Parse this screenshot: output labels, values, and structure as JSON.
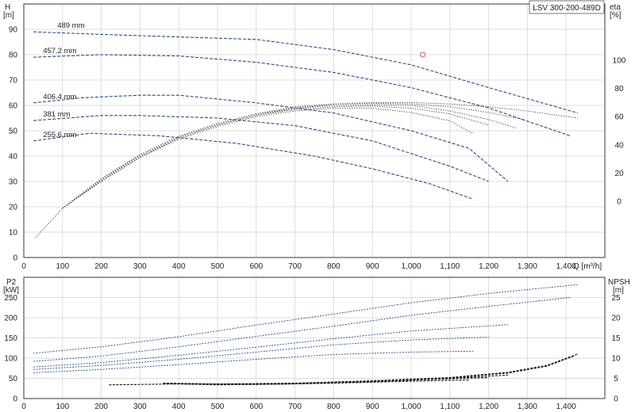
{
  "badge": "LSV 300-200-489D",
  "colors": {
    "curve": "#1f4e8c",
    "eff": "#555555",
    "npsh": "#111111",
    "grid": "#d0d0d0",
    "marker": "#e05050"
  },
  "chart_data": [
    {
      "type": "line",
      "panel": "head",
      "ylabel_name": "H",
      "ylabel_unit": "[m]",
      "y2label_name": "eta",
      "y2label_unit": "[%]",
      "xlabel": "Q [m³/h]",
      "xlim": [
        0,
        1500
      ],
      "ylim": [
        0,
        100
      ],
      "y2lim": [
        -40,
        140
      ],
      "xticks": [
        0,
        100,
        200,
        300,
        400,
        500,
        600,
        700,
        800,
        900,
        1000,
        1100,
        1200,
        1300,
        1400
      ],
      "xtick_labels": [
        "0",
        "100",
        "200",
        "300",
        "400",
        "500",
        "600",
        "700",
        "800",
        "900",
        "1,000",
        "1,100",
        "1,200",
        "1,300",
        "1,400"
      ],
      "yticks": [
        0,
        10,
        20,
        30,
        40,
        50,
        60,
        70,
        80,
        90
      ],
      "y2ticks": [
        0,
        20,
        40,
        60,
        80,
        100
      ],
      "series": [
        {
          "name": "489 mm",
          "x": [
            25,
            200,
            400,
            600,
            800,
            1000,
            1200,
            1430
          ],
          "y": [
            89,
            88,
            87,
            86,
            82,
            76,
            67,
            57
          ]
        },
        {
          "name": "457.2 mm",
          "x": [
            25,
            200,
            400,
            600,
            800,
            1000,
            1200,
            1410
          ],
          "y": [
            79,
            80,
            79.5,
            77,
            73,
            67,
            59,
            48
          ]
        },
        {
          "name": "406.4 mm",
          "x": [
            25,
            150,
            300,
            400,
            600,
            800,
            1000,
            1150,
            1250
          ],
          "y": [
            61,
            63,
            64,
            64,
            61,
            57,
            50,
            43,
            30
          ]
        },
        {
          "name": "381 mm",
          "x": [
            25,
            200,
            300,
            500,
            700,
            900,
            1100,
            1200
          ],
          "y": [
            54,
            56,
            56,
            55,
            52,
            46,
            36,
            30
          ]
        },
        {
          "name": "255.6 mm",
          "x": [
            25,
            170,
            350,
            550,
            750,
            900,
            1050,
            1160
          ],
          "y": [
            46,
            49,
            48,
            45,
            40,
            35,
            29,
            23
          ]
        }
      ],
      "efficiency": [
        {
          "x": [
            100,
            200,
            300,
            400,
            500,
            600,
            700,
            800,
            900,
            1000,
            1100,
            1200,
            1300,
            1430
          ],
          "y": [
            -5,
            16,
            33,
            46,
            55,
            62,
            67,
            69,
            70,
            70,
            69,
            67,
            64,
            59
          ]
        },
        {
          "x": [
            100,
            200,
            300,
            400,
            500,
            600,
            700,
            800,
            900,
            1000,
            1100,
            1200,
            1290
          ],
          "y": [
            -5,
            15,
            33,
            46,
            55,
            62,
            66,
            69,
            69.5,
            69,
            67,
            63,
            58
          ]
        },
        {
          "x": [
            100,
            200,
            300,
            400,
            500,
            600,
            700,
            800,
            900,
            1000,
            1100,
            1200,
            1270
          ],
          "y": [
            -5,
            15,
            32,
            45,
            54,
            61,
            66,
            68,
            68.5,
            68,
            64,
            58,
            52
          ]
        },
        {
          "x": [
            100,
            200,
            300,
            400,
            500,
            600,
            700,
            800,
            900,
            1000,
            1100,
            1200
          ],
          "y": [
            -5,
            14,
            31,
            45,
            54,
            61,
            65,
            67,
            67.5,
            66,
            62,
            54
          ]
        },
        {
          "x": [
            30,
            100,
            200,
            300,
            400,
            500,
            600,
            700,
            800,
            900,
            1000,
            1100,
            1160
          ],
          "y": [
            -26,
            -5,
            14,
            31,
            44,
            53,
            60,
            64,
            66,
            66,
            63,
            57,
            48
          ]
        }
      ],
      "operating_point": {
        "x": 1030,
        "y": 80
      }
    },
    {
      "type": "line",
      "panel": "power",
      "ylabel_name": "P2",
      "ylabel_unit": "[kW]",
      "y2label_name": "NPSH",
      "y2label_unit": "[m]",
      "xlim": [
        0,
        1500
      ],
      "ylim": [
        0,
        300
      ],
      "y2lim": [
        0,
        30
      ],
      "yticks": [
        0,
        50,
        100,
        150,
        200,
        250
      ],
      "y2ticks": [
        0,
        5,
        10,
        15,
        20,
        25
      ],
      "power": [
        {
          "x": [
            25,
            200,
            400,
            600,
            800,
            1000,
            1200,
            1430
          ],
          "y": [
            112,
            128,
            153,
            182,
            209,
            237,
            260,
            282
          ]
        },
        {
          "x": [
            25,
            200,
            400,
            600,
            800,
            1000,
            1200,
            1410
          ],
          "y": [
            92,
            105,
            128,
            154,
            179,
            206,
            228,
            250
          ]
        },
        {
          "x": [
            25,
            200,
            400,
            600,
            800,
            1000,
            1250
          ],
          "y": [
            78,
            89,
            107,
            127,
            148,
            167,
            183
          ]
        },
        {
          "x": [
            25,
            200,
            400,
            600,
            800,
            1000,
            1200
          ],
          "y": [
            72,
            82,
            97,
            115,
            133,
            145,
            152
          ]
        },
        {
          "x": [
            25,
            200,
            400,
            600,
            800,
            1000,
            1160
          ],
          "y": [
            64,
            72,
            84,
            97,
            109,
            115,
            117
          ]
        }
      ],
      "npsh": [
        {
          "x": [
            360,
            500,
            700,
            900,
            1100,
            1250,
            1350,
            1430
          ],
          "y": [
            3.8,
            3.6,
            3.8,
            4.4,
            5.2,
            6.5,
            8.2,
            11
          ]
        },
        {
          "x": [
            360,
            500,
            700,
            900,
            1100,
            1250,
            1350,
            1420
          ],
          "y": [
            3.8,
            3.5,
            3.7,
            4.3,
            5.1,
            6.3,
            8.0,
            10.5
          ]
        },
        {
          "x": [
            360,
            500,
            700,
            900,
            1100,
            1250
          ],
          "y": [
            3.7,
            3.5,
            3.7,
            4.2,
            5.0,
            5.8
          ]
        },
        {
          "x": [
            360,
            500,
            700,
            900,
            1100,
            1200
          ],
          "y": [
            3.7,
            3.4,
            3.6,
            4.2,
            4.9,
            5.2
          ]
        },
        {
          "x": [
            220,
            400,
            600,
            800,
            1000,
            1150
          ],
          "y": [
            3.4,
            3.6,
            3.5,
            3.8,
            4.3,
            4.6
          ]
        }
      ]
    }
  ]
}
